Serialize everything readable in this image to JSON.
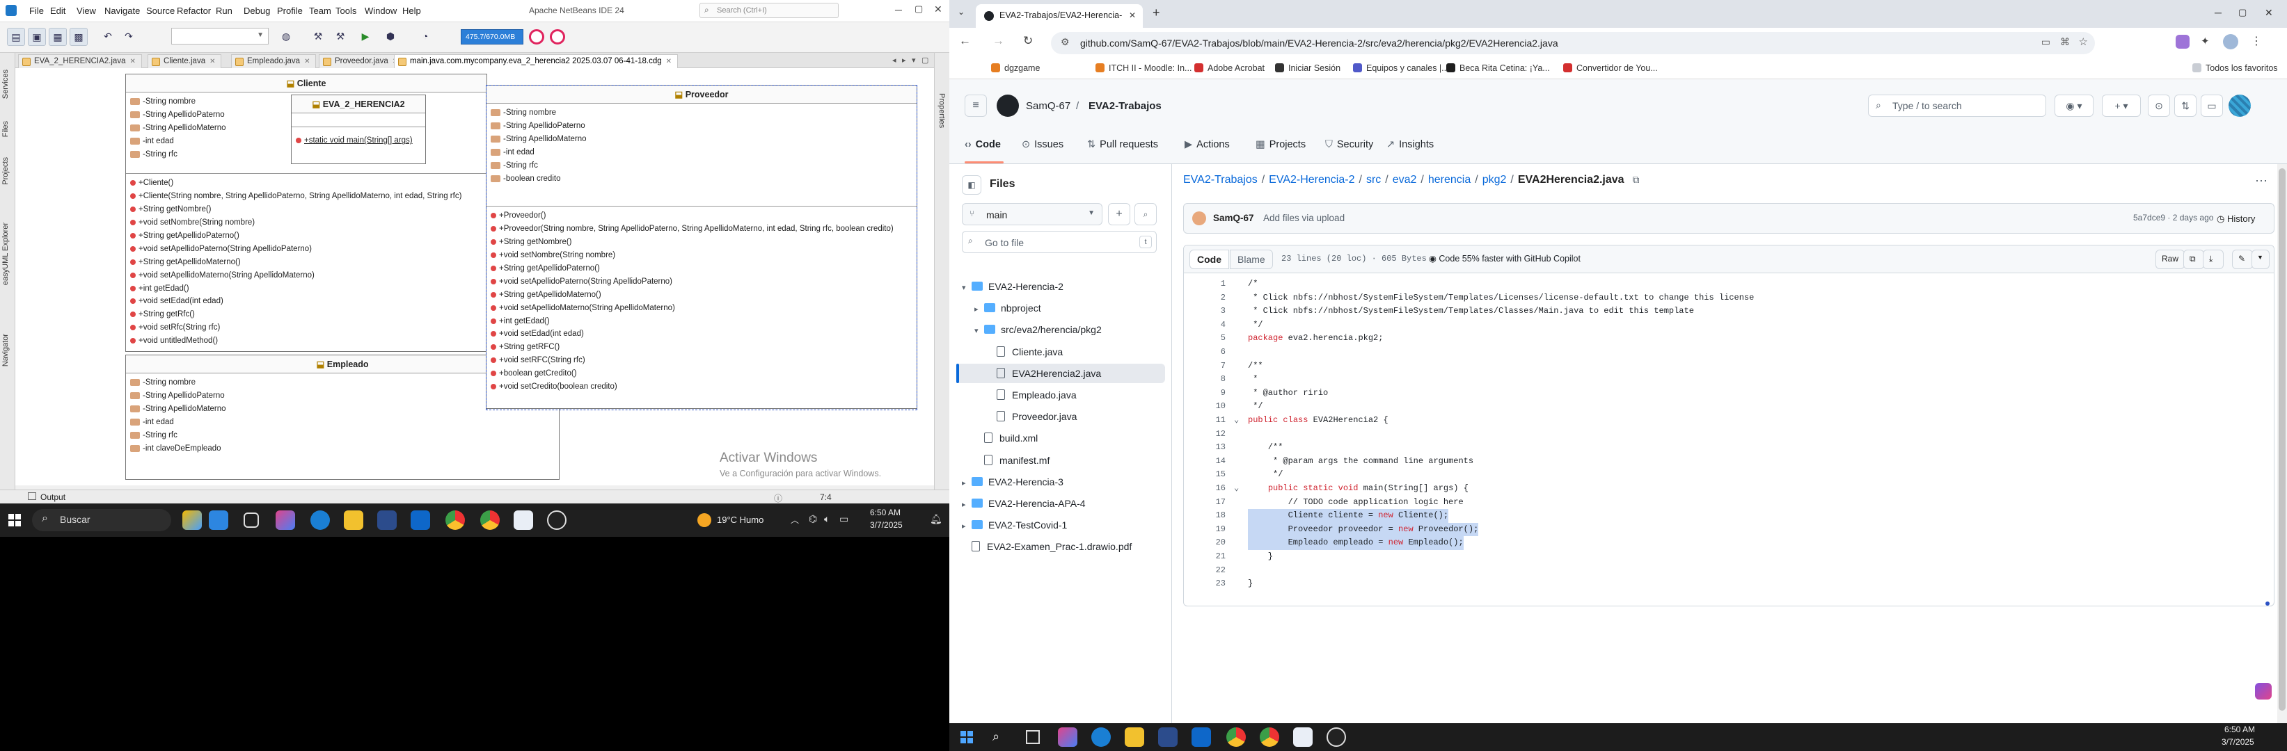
{
  "netbeans": {
    "title": "Apache NetBeans IDE 24",
    "search_placeholder": "Search (Ctrl+I)",
    "menu": [
      "File",
      "Edit",
      "View",
      "Navigate",
      "Source",
      "Refactor",
      "Run",
      "Debug",
      "Profile",
      "Team",
      "Tools",
      "Window",
      "Help"
    ],
    "memory": "475.7/670.0MB",
    "left_panels": [
      "Services",
      "Files",
      "Projects",
      "easyUML Explorer",
      "Navigator"
    ],
    "right_panels": [
      "Properties"
    ],
    "tabs": [
      "EVA_2_HERENCIA2.java",
      "Cliente.java",
      "Empleado.java",
      "Proveedor.java",
      "main.java.com.mycompany.eva_2_herencia2 2025.03.07 06-41-18.cdg"
    ],
    "cliente": {
      "name": "Cliente",
      "attrs": [
        "-String nombre",
        "-String ApellidoPaterno",
        "-String ApellidoMaterno",
        "-int edad",
        "-String rfc"
      ],
      "methods": [
        "+Cliente()",
        "+Cliente(String nombre, String ApellidoPaterno, String ApellidoMaterno, int edad, String rfc)",
        "+String getNombre()",
        "+void setNombre(String nombre)",
        "+String getApellidoPaterno()",
        "+void setApellidoPaterno(String ApellidoPaterno)",
        "+String getApellidoMaterno()",
        "+void setApellidoMaterno(String ApellidoMaterno)",
        "+int getEdad()",
        "+void setEdad(int edad)",
        "+String getRfc()",
        "+void setRfc(String rfc)",
        "+void untitledMethod()"
      ]
    },
    "eva": {
      "name": "EVA_2_HERENCIA2",
      "method": "+static void main(String[] args)"
    },
    "proveedor": {
      "name": "Proveedor",
      "attrs": [
        "-String nombre",
        "-String ApellidoPaterno",
        "-String ApellidoMaterno",
        "-int edad",
        "-String rfc",
        "-boolean credito"
      ],
      "methods": [
        "+Proveedor()",
        "+Proveedor(String nombre, String ApellidoPaterno, String ApellidoMaterno, int edad, String rfc, boolean credito)",
        "+String getNombre()",
        "+void setNombre(String nombre)",
        "+String getApellidoPaterno()",
        "+void setApellidoPaterno(String ApellidoPaterno)",
        "+String getApellidoMaterno()",
        "+void setApellidoMaterno(String ApellidoMaterno)",
        "+int getEdad()",
        "+void setEdad(int edad)",
        "+String getRFC()",
        "+void setRFC(String rfc)",
        "+boolean getCredito()",
        "+void setCredito(boolean credito)"
      ]
    },
    "empleado": {
      "name": "Empleado",
      "attrs": [
        "-String nombre",
        "-String ApellidoPaterno",
        "-String ApellidoMaterno",
        "-int edad",
        "-String rfc",
        "-int claveDeEmpleado"
      ]
    },
    "watermark_title": "Activar Windows",
    "watermark_sub": "Ve a Configuración para activar Windows.",
    "output_label": "Output",
    "status_pos": "7:4"
  },
  "taskbar_left": {
    "search": "Buscar",
    "weather": "19°C  Humo",
    "time": "6:50 AM",
    "date": "3/7/2025"
  },
  "browser": {
    "tab_title": "EVA2-Trabajos/EVA2-Herencia-",
    "url": "github.com/SamQ-67/EVA2-Trabajos/blob/main/EVA2-Herencia-2/src/eva2/herencia/pkg2/EVA2Herencia2.java",
    "bookmarks": [
      "dgzgame",
      "ITCH II - Moodle: In...",
      "Adobe Acrobat",
      "Iniciar Sesión",
      "Equipos y canales |...",
      "Beca Rita Cetina: ¡Ya...",
      "Convertidor de You..."
    ],
    "all_bookmarks": "Todos los favoritos"
  },
  "github": {
    "owner": "SamQ-67",
    "sep": "/",
    "repo": "EVA2-Trabajos",
    "search_placeholder": "Type / to search",
    "nav": [
      "Code",
      "Issues",
      "Pull requests",
      "Actions",
      "Projects",
      "Security",
      "Insights"
    ],
    "files_label": "Files",
    "branch": "main",
    "goto_placeholder": "Go to file",
    "goto_key": "t",
    "tree": [
      {
        "label": "EVA2-Herencia-2",
        "type": "folder",
        "depth": 0,
        "open": true
      },
      {
        "label": "nbproject",
        "type": "folder",
        "depth": 1,
        "open": false
      },
      {
        "label": "src/eva2/herencia/pkg2",
        "type": "folder",
        "depth": 1,
        "open": true
      },
      {
        "label": "Cliente.java",
        "type": "file",
        "depth": 2
      },
      {
        "label": "EVA2Herencia2.java",
        "type": "file",
        "depth": 2,
        "selected": true
      },
      {
        "label": "Empleado.java",
        "type": "file",
        "depth": 2
      },
      {
        "label": "Proveedor.java",
        "type": "file",
        "depth": 2
      },
      {
        "label": "build.xml",
        "type": "file",
        "depth": 1
      },
      {
        "label": "manifest.mf",
        "type": "file",
        "depth": 1
      },
      {
        "label": "EVA2-Herencia-3",
        "type": "folder",
        "depth": 0,
        "open": false
      },
      {
        "label": "EVA2-Herencia-APA-4",
        "type": "folder",
        "depth": 0,
        "open": false
      },
      {
        "label": "EVA2-TestCovid-1",
        "type": "folder",
        "depth": 0,
        "open": false
      },
      {
        "label": "EVA2-Examen_Prac-1.drawio.pdf",
        "type": "file",
        "depth": 0
      }
    ],
    "path": [
      "EVA2-Trabajos",
      "EVA2-Herencia-2",
      "src",
      "eva2",
      "herencia",
      "pkg2"
    ],
    "path_file": "EVA2Herencia2.java",
    "commit_author": "SamQ-67",
    "commit_msg": "Add files via upload",
    "commit_meta": "5a7dce9 · 2 days ago",
    "history": "History",
    "code_tab": "Code",
    "blame_tab": "Blame",
    "file_stats": "23 lines (20 loc) · 605 Bytes",
    "copilot": "Code 55% faster with GitHub Copilot",
    "raw": "Raw",
    "code": [
      {
        "n": "1",
        "t": "/*",
        "c": "cm"
      },
      {
        "n": "2",
        "t": " * Click nbfs://nbhost/SystemFileSystem/Templates/Licenses/license-default.txt to change this license",
        "c": "cm"
      },
      {
        "n": "3",
        "t": " * Click nbfs://nbhost/SystemFileSystem/Templates/Classes/Main.java to edit this template",
        "c": "cm"
      },
      {
        "n": "4",
        "t": " */",
        "c": "cm"
      },
      {
        "n": "5",
        "t": "package eva2.herencia.pkg2;",
        "c": ""
      },
      {
        "n": "6",
        "t": "",
        "c": ""
      },
      {
        "n": "7",
        "t": "/**",
        "c": "cm"
      },
      {
        "n": "8",
        "t": " *",
        "c": "cm"
      },
      {
        "n": "9",
        "t": " * @author ririo",
        "c": "cm"
      },
      {
        "n": "10",
        "t": " */",
        "c": "cm"
      },
      {
        "n": "11",
        "t": "public class EVA2Herencia2 {",
        "c": ""
      },
      {
        "n": "12",
        "t": "",
        "c": ""
      },
      {
        "n": "13",
        "t": "    /**",
        "c": "cm"
      },
      {
        "n": "14",
        "t": "     * @param args the command line arguments",
        "c": "cm"
      },
      {
        "n": "15",
        "t": "     */",
        "c": "cm"
      },
      {
        "n": "16",
        "t": "    public static void main(String[] args) {",
        "c": ""
      },
      {
        "n": "17",
        "t": "        // TODO code application logic here",
        "c": "cm"
      },
      {
        "n": "18",
        "t": "        Cliente cliente = new Cliente();",
        "c": "hl"
      },
      {
        "n": "19",
        "t": "        Proveedor proveedor = new Proveedor();",
        "c": "hl"
      },
      {
        "n": "20",
        "t": "        Empleado empleado = new Empleado();",
        "c": "hl"
      },
      {
        "n": "21",
        "t": "    }",
        "c": ""
      },
      {
        "n": "22",
        "t": "",
        "c": ""
      },
      {
        "n": "23",
        "t": "}",
        "c": ""
      }
    ]
  },
  "taskbar_right": {
    "time": "6:50 AM",
    "date": "3/7/2025"
  }
}
